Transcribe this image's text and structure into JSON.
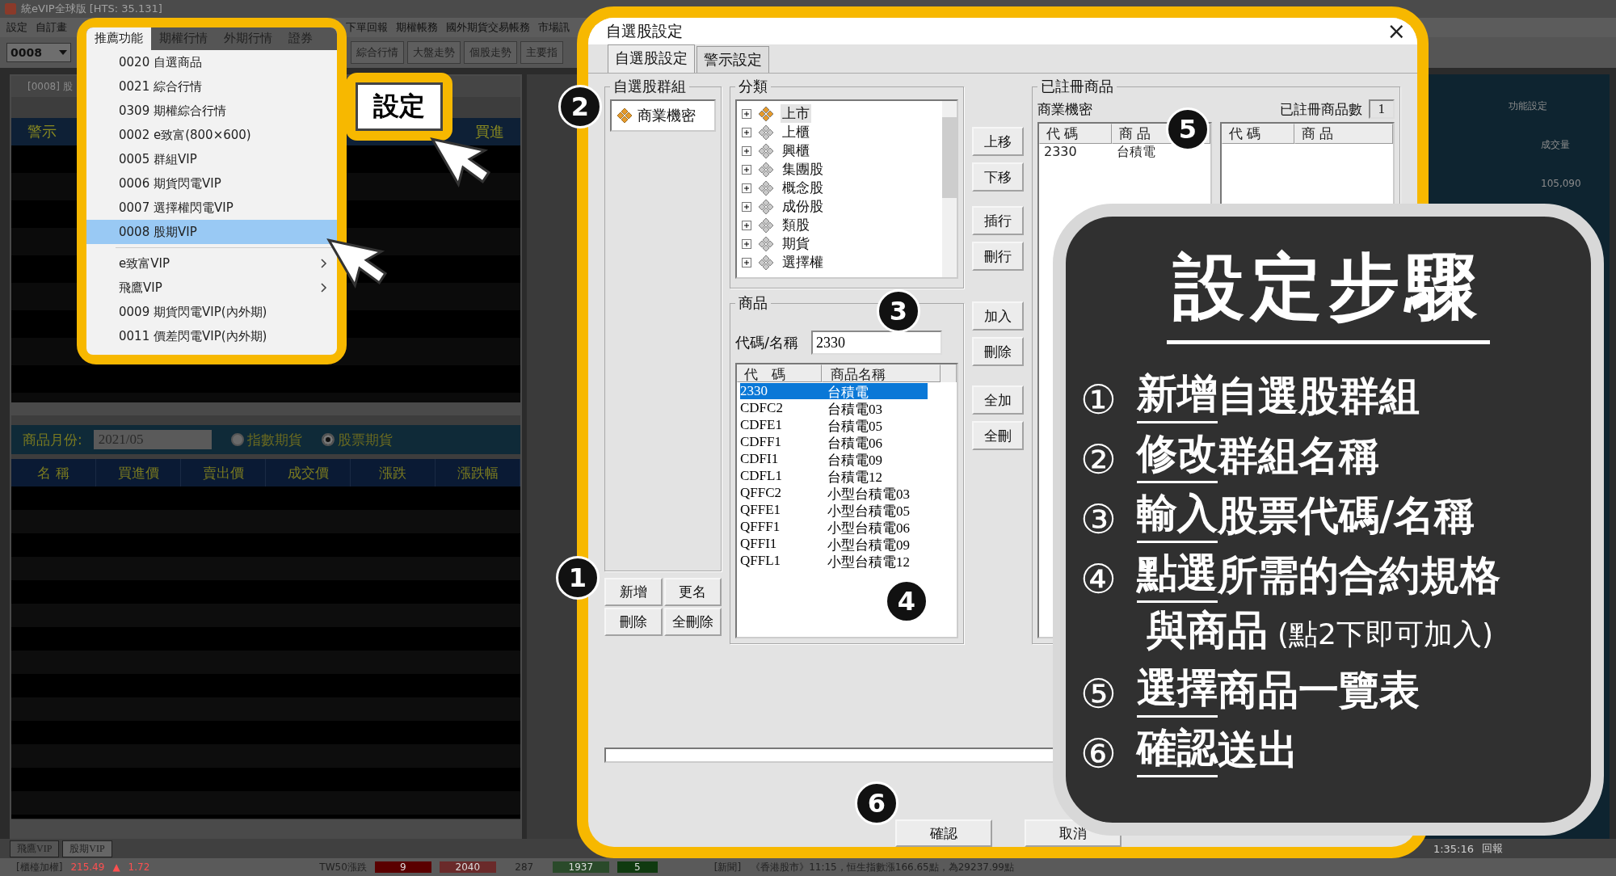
{
  "app": {
    "title": "統eVIP全球版 [HTS: 35.131]",
    "menu": [
      "設定",
      "自訂畫",
      "下單回報",
      "期權帳務",
      "國外期貨交易帳務",
      "市場訊"
    ],
    "code_combo": "0008",
    "toolbar": [
      "綜合行情",
      "大盤走勢",
      "個股走勢",
      "主要指"
    ]
  },
  "left_window": {
    "title": "[0008] 股",
    "header": [
      "警示",
      "買進"
    ],
    "month_label": "商品月份:",
    "month": "2021/05",
    "radios": [
      {
        "label": "指數期貨",
        "selected": false
      },
      {
        "label": "股票期貨",
        "selected": true
      }
    ],
    "columns": [
      "名 稱",
      "買進價",
      "賣出價",
      "成交價",
      "漲跌",
      "漲跌幅"
    ]
  },
  "right_window": {
    "tab": "功能設定",
    "column": "成交量",
    "value": "105,090"
  },
  "bottom_tabs": [
    {
      "label": "飛鷹VIP",
      "selected": false
    },
    {
      "label": "股期VIP",
      "selected": true
    }
  ],
  "status_bar": {
    "index_name": "[櫃檯加權]",
    "index_value": "215.49",
    "change_arrow": "▲",
    "change": "1.72",
    "tw50_label": "TW50漲跌",
    "tw50_up": "9",
    "tw50_down": "2040",
    "count_1": "287",
    "count_2": "1937",
    "count_3": "5",
    "news": "[新聞]　《香港股市》11:15，恒生指數漲166.65點，為29237.99點",
    "time": "1:35:16",
    "report": "回報"
  },
  "popup_menu": {
    "tabs": [
      {
        "label": "推薦功能",
        "selected": true
      },
      {
        "label": "期權行情",
        "selected": false
      },
      {
        "label": "外期行情",
        "selected": false
      },
      {
        "label": "證券",
        "selected": false
      }
    ],
    "items": [
      {
        "label": "0020 自選商品",
        "kind": "item",
        "selected": false
      },
      {
        "label": "0021 綜合行情",
        "kind": "item",
        "selected": false
      },
      {
        "label": "0309 期權綜合行情",
        "kind": "item",
        "selected": false
      },
      {
        "label": "0002 e致富(800×600)",
        "kind": "item",
        "selected": false
      },
      {
        "label": "0005 群組VIP",
        "kind": "item",
        "selected": false
      },
      {
        "label": "0006 期貨閃電VIP",
        "kind": "item",
        "selected": false
      },
      {
        "label": "0007 選擇權閃電VIP",
        "kind": "item",
        "selected": false
      },
      {
        "label": "0008 股期VIP",
        "kind": "item",
        "selected": true
      },
      {
        "label": "e致富VIP",
        "kind": "submenu",
        "selected": false
      },
      {
        "label": "飛鷹VIP",
        "kind": "submenu",
        "selected": false
      },
      {
        "label": "0009 期貨閃電VIP(內外期)",
        "kind": "item",
        "selected": false
      },
      {
        "label": "0011 價差閃電VIP(內外期)",
        "kind": "item",
        "selected": false
      }
    ]
  },
  "callout": {
    "button": "設定"
  },
  "dialog": {
    "title": "自選股設定",
    "close": "×",
    "tabs": [
      {
        "label": "自選股設定",
        "selected": true
      },
      {
        "label": "警示設定",
        "selected": false
      }
    ],
    "groups": {
      "title": "自選股群組",
      "items": [
        {
          "name": "商業機密",
          "selected": false
        }
      ],
      "buttons": [
        "新增",
        "更名",
        "刪除",
        "全刪除"
      ]
    },
    "category": {
      "title": "分類",
      "items": [
        {
          "name": "上市",
          "selected": true
        },
        {
          "name": "上櫃",
          "selected": false
        },
        {
          "name": "興櫃",
          "selected": false
        },
        {
          "name": "集團股",
          "selected": false
        },
        {
          "name": "概念股",
          "selected": false
        },
        {
          "name": "成份股",
          "selected": false
        },
        {
          "name": "類股",
          "selected": false
        },
        {
          "name": "期貨",
          "selected": false
        },
        {
          "name": "選擇權",
          "selected": false
        }
      ]
    },
    "product": {
      "title": "商品",
      "field_label": "代碼/名稱",
      "field_value": "2330",
      "columns": [
        "代　碼",
        "商品名稱"
      ],
      "rows": [
        {
          "code": "2330",
          "name": "台積電",
          "selected": true
        },
        {
          "code": "CDFC2",
          "name": "台積電03",
          "selected": false
        },
        {
          "code": "CDFE1",
          "name": "台積電05",
          "selected": false
        },
        {
          "code": "CDFF1",
          "name": "台積電06",
          "selected": false
        },
        {
          "code": "CDFI1",
          "name": "台積電09",
          "selected": false
        },
        {
          "code": "CDFL1",
          "name": "台積電12",
          "selected": false
        },
        {
          "code": "QFFC2",
          "name": "小型台積電03",
          "selected": false
        },
        {
          "code": "QFFE1",
          "name": "小型台積電05",
          "selected": false
        },
        {
          "code": "QFFF1",
          "name": "小型台積電06",
          "selected": false
        },
        {
          "code": "QFFI1",
          "name": "小型台積電09",
          "selected": false
        },
        {
          "code": "QFFL1",
          "name": "小型台積電12",
          "selected": false
        }
      ]
    },
    "move_buttons": [
      "上移",
      "下移",
      "插行",
      "刪行"
    ],
    "add_buttons": [
      "加入",
      "刪除"
    ],
    "all_buttons": [
      "全加",
      "全刪"
    ],
    "registered": {
      "title": "已註冊商品",
      "group_name": "商業機密",
      "count_label": "已註冊商品數",
      "count": "1",
      "left_columns": [
        "代 碼",
        "商 品"
      ],
      "left_rows": [
        {
          "code": "2330",
          "name": "台積電"
        }
      ],
      "right_columns": [
        "代 碼",
        "商 品"
      ]
    },
    "footer_buttons": [
      "確認",
      "取消"
    ]
  },
  "steps_card": {
    "title": "設定步驟",
    "steps": [
      {
        "num": "①",
        "underlined": "新增",
        "rest": "自選股群組"
      },
      {
        "num": "②",
        "underlined": "修改",
        "rest": "群組名稱"
      },
      {
        "num": "③",
        "underlined": "輸入",
        "rest": "股票代碼/名稱"
      },
      {
        "num": "④",
        "underlined": "點選",
        "rest": "所需的合約規格",
        "line2": "與商品",
        "note": "(點2下即可加入)"
      },
      {
        "num": "⑤",
        "underlined": "選擇",
        "rest": "商品一覽表"
      },
      {
        "num": "⑥",
        "underlined": "確認",
        "rest": "送出"
      }
    ]
  },
  "markers": [
    "1",
    "2",
    "3",
    "4",
    "5",
    "6"
  ]
}
